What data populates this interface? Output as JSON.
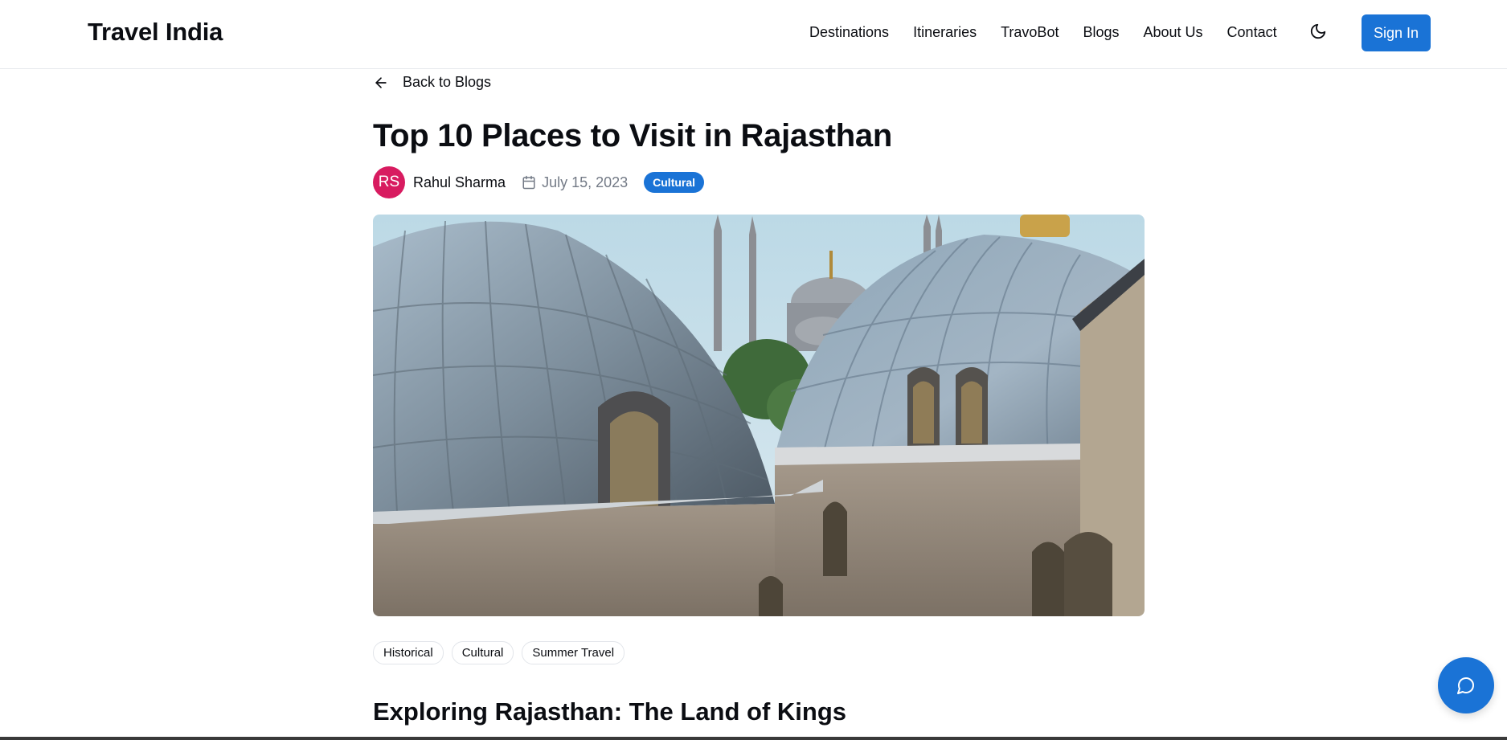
{
  "header": {
    "brand": "Travel India",
    "nav": [
      "Destinations",
      "Itineraries",
      "TravoBot",
      "Blogs",
      "About Us",
      "Contact"
    ],
    "theme_icon": "moon-icon",
    "signin_label": "Sign In"
  },
  "article": {
    "back_label": "Back to Blogs",
    "title": "Top 10 Places to Visit in Rajasthan",
    "author_initials": "RS",
    "author_name": "Rahul Sharma",
    "date": "July 15, 2023",
    "category": "Cultural",
    "hero_image_icon": "domed-mosque-photo",
    "tags": [
      "Historical",
      "Cultural",
      "Summer Travel"
    ],
    "section_heading": "Exploring Rajasthan: The Land of Kings"
  },
  "chat": {
    "icon": "chat-bubble-icon"
  },
  "colors": {
    "accent": "#1a73d6",
    "avatar": "#d81b60",
    "text": "#0b0d12",
    "muted": "#737a86"
  }
}
